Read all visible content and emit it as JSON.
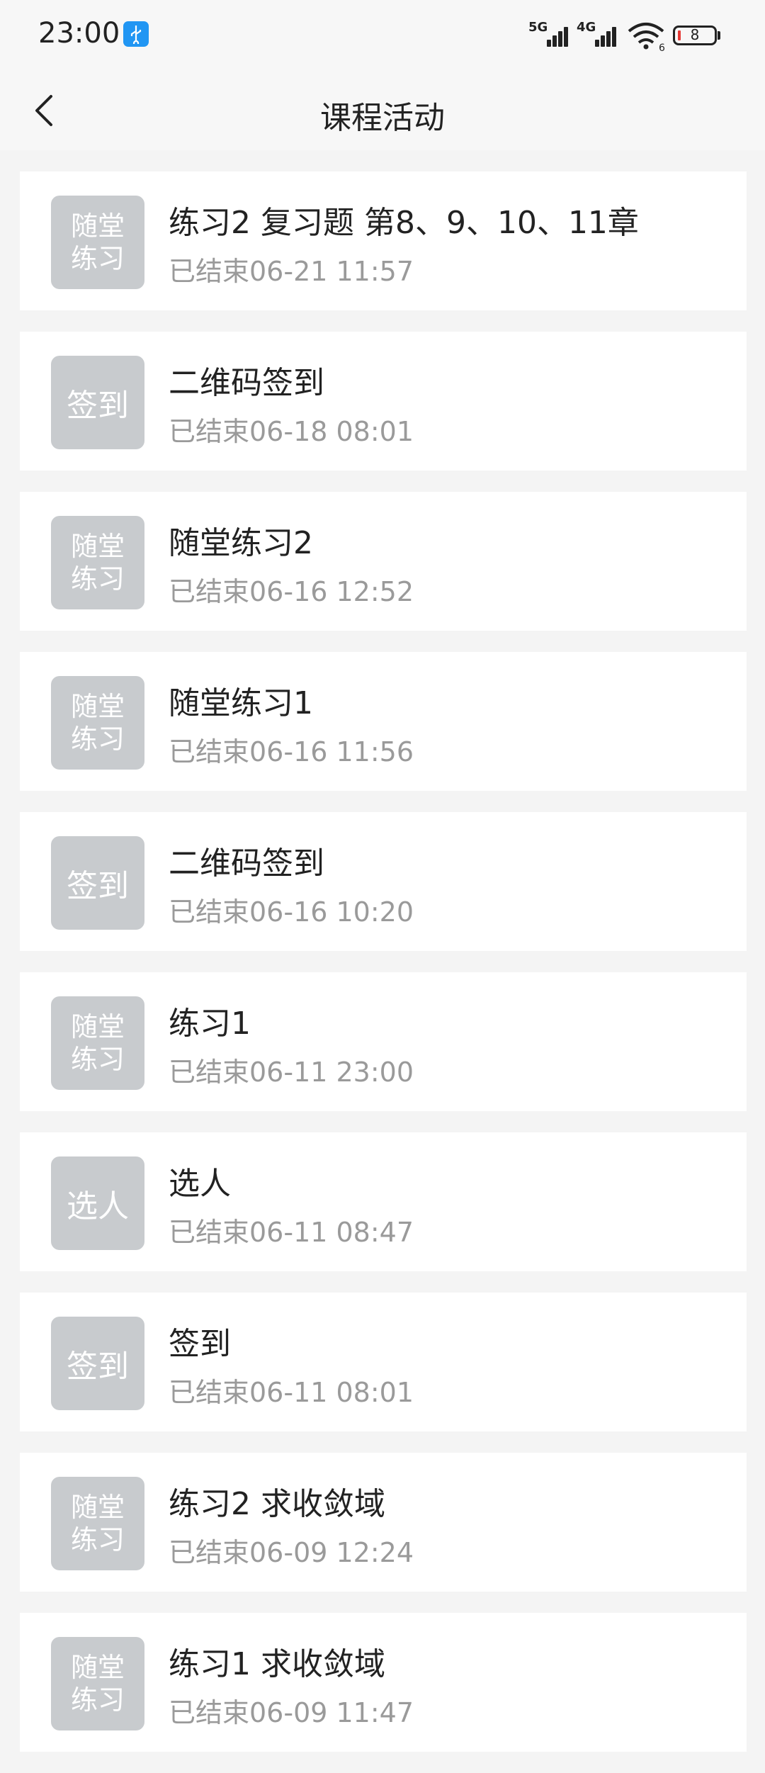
{
  "status_bar": {
    "time": "23:00",
    "signal1_label": "5G",
    "signal2_label": "4G",
    "wifi_label": "6",
    "battery": "8"
  },
  "header": {
    "title": "课程活动"
  },
  "activities": [
    {
      "badge": [
        "随堂",
        "练习"
      ],
      "title": "练习2 复习题 第8、9、10、11章",
      "status": "已结束06-21 11:57"
    },
    {
      "badge": [
        "签到"
      ],
      "title": "二维码签到",
      "status": "已结束06-18 08:01"
    },
    {
      "badge": [
        "随堂",
        "练习"
      ],
      "title": "随堂练习2",
      "status": "已结束06-16 12:52"
    },
    {
      "badge": [
        "随堂",
        "练习"
      ],
      "title": "随堂练习1",
      "status": "已结束06-16 11:56"
    },
    {
      "badge": [
        "签到"
      ],
      "title": "二维码签到",
      "status": "已结束06-16 10:20"
    },
    {
      "badge": [
        "随堂",
        "练习"
      ],
      "title": "练习1",
      "status": "已结束06-11 23:00"
    },
    {
      "badge": [
        "选人"
      ],
      "title": "选人",
      "status": "已结束06-11 08:47"
    },
    {
      "badge": [
        "签到"
      ],
      "title": "签到",
      "status": "已结束06-11 08:01"
    },
    {
      "badge": [
        "随堂",
        "练习"
      ],
      "title": "练习2 求收敛域",
      "status": "已结束06-09 12:24"
    },
    {
      "badge": [
        "随堂",
        "练习"
      ],
      "title": "练习1 求收敛域",
      "status": "已结束06-09 11:47"
    }
  ]
}
